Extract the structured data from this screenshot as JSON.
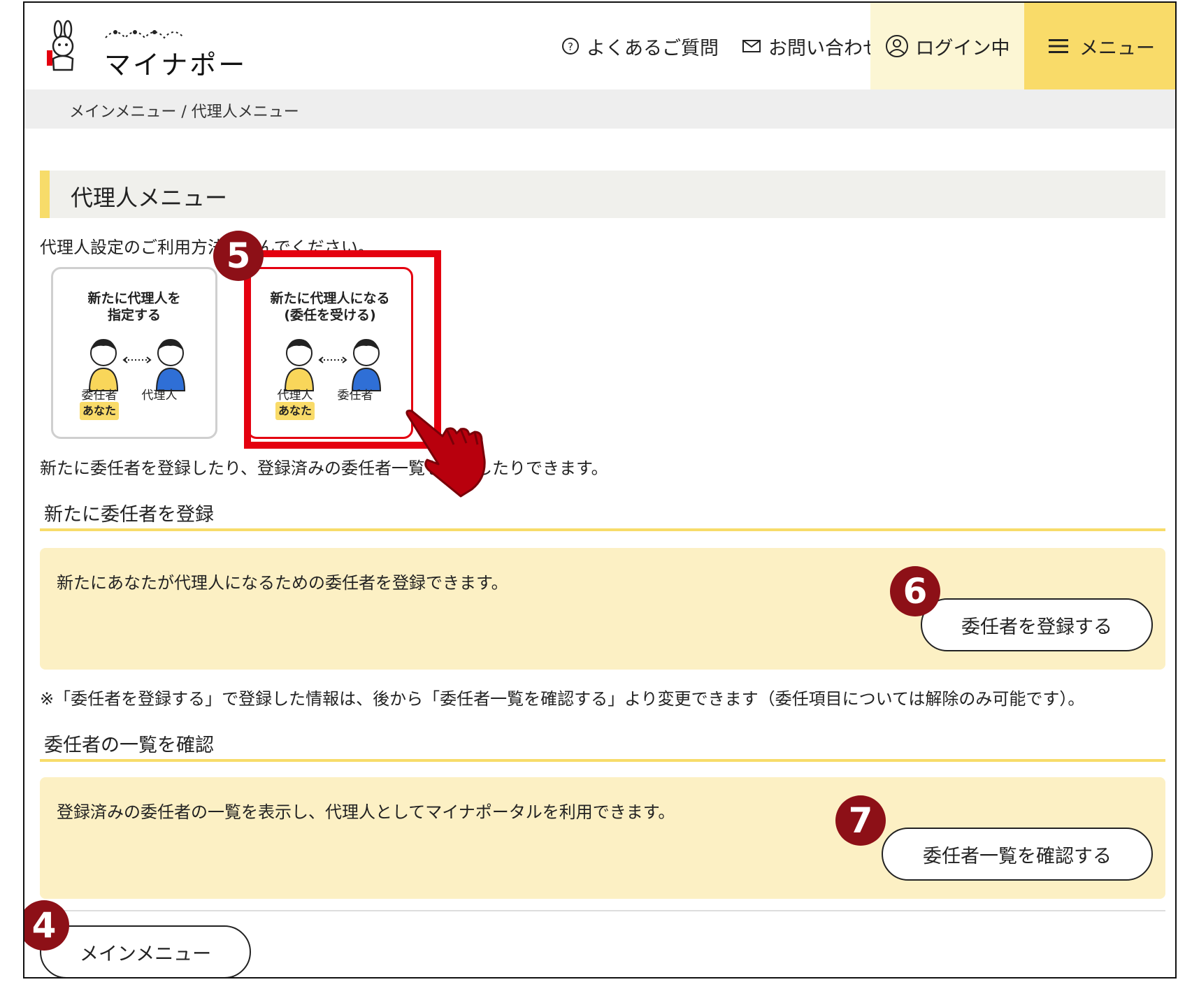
{
  "header": {
    "logo_text": "マイナポータル",
    "faq_label": "よくあるご質問",
    "contact_label": "お問い合わせ",
    "login_label": "ログイン中",
    "menu_label": "メニュー"
  },
  "breadcrumb": "メインメニュー / 代理人メニュー",
  "page_title": "代理人メニュー",
  "lead_text": "代理人設定のご利用方法を選んでください。",
  "cards": [
    {
      "title_line1": "新たに代理人を",
      "title_line2": "指定する",
      "left_label": "委任者",
      "right_label": "代理人",
      "you_label": "あなた"
    },
    {
      "title_line1": "新たに代理人になる",
      "title_line2": "(委任を受ける)",
      "left_label": "代理人",
      "right_label": "委任者",
      "you_label": "あなた"
    }
  ],
  "description": "新たに委任者を登録したり、登録済みの委任者一覧を確認したりできます。",
  "register_section": {
    "heading": "新たに委任者を登録",
    "text": "新たにあなたが代理人になるための委任者を登録できます。",
    "button": "委任者を登録する"
  },
  "note": "※「委任者を登録する」で登録した情報は、後から「委任者一覧を確認する」より変更できます（委任項目については解除のみ可能です）。",
  "list_section": {
    "heading": "委任者の一覧を確認",
    "text": "登録済みの委任者の一覧を表示し、代理人としてマイナポータルを利用できます。",
    "button": "委任者一覧を確認する"
  },
  "main_menu_button": "メインメニュー",
  "step_badges": {
    "card": "5",
    "register": "6",
    "list": "7",
    "main_menu": "4"
  },
  "colors": {
    "accent_yellow": "#f9db69",
    "highlight_red": "#e4000f",
    "badge": "#8d1017",
    "panel": "#fcf0c4"
  }
}
